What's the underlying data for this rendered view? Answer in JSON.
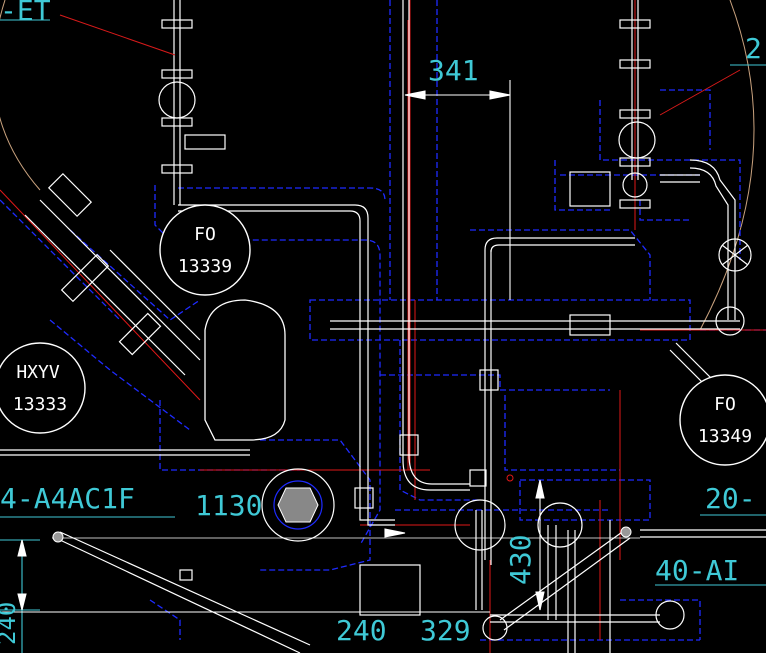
{
  "colors": {
    "background": "#000000",
    "pipe": "#ffffff",
    "hidden": "#1e2bff",
    "dimension": "#3fc9d6",
    "centerline": "#e01818",
    "leader": "#d81a1a",
    "arc": "#c9a27e"
  },
  "labels": {
    "top_left": "-ET",
    "top_right": "2",
    "dim_341": "341",
    "dim_1130": "1130",
    "dim_430": "430",
    "dim_240": "240",
    "dim_329": "329",
    "line_left": "4-A4AC1F",
    "line_right_20": "20-",
    "line_right_40": "40-AI",
    "left_vertical": "240"
  },
  "tags": [
    {
      "name": "tag-fo-13339",
      "type": "FO",
      "number": "13339"
    },
    {
      "name": "tag-hxyv-13333",
      "type": "HXYV",
      "number": "13333"
    },
    {
      "name": "tag-fo-13349",
      "type": "FO",
      "number": "13349"
    }
  ]
}
